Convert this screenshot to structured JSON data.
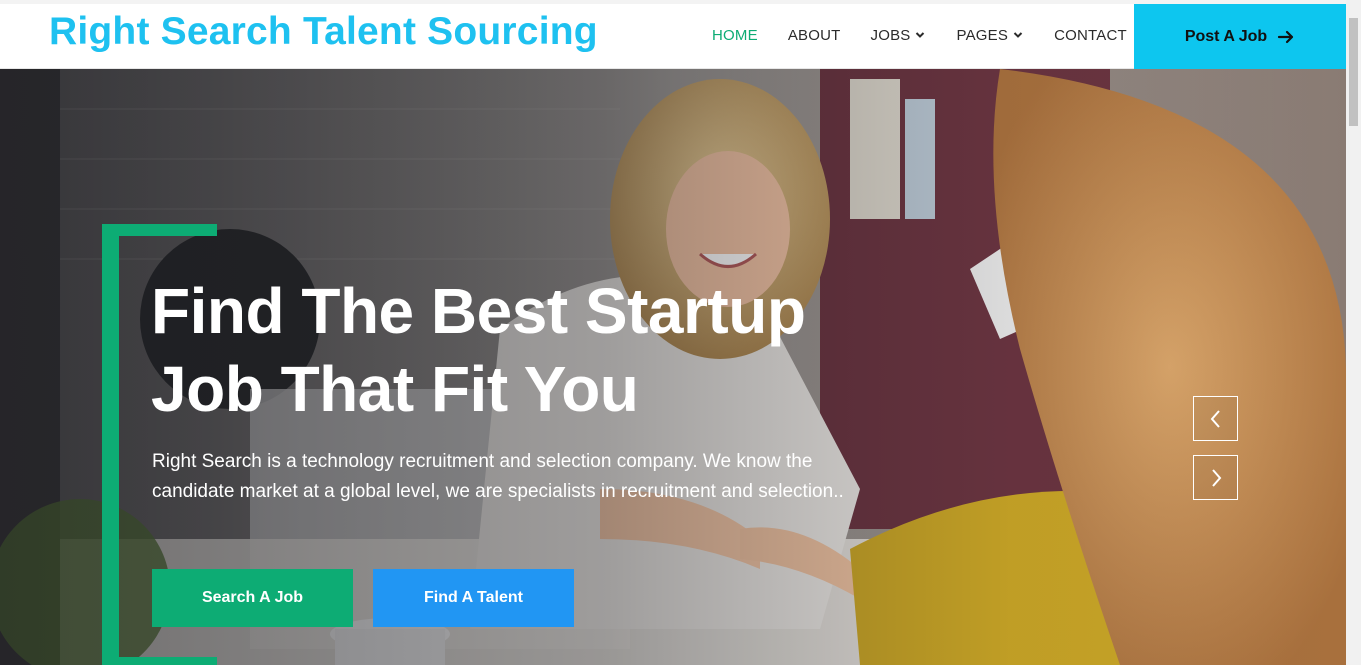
{
  "header": {
    "brand": "Right Search Talent Sourcing",
    "nav": [
      {
        "label": "HOME",
        "active": true,
        "dropdown": false
      },
      {
        "label": "ABOUT",
        "active": false,
        "dropdown": false
      },
      {
        "label": "JOBS",
        "active": false,
        "dropdown": true
      },
      {
        "label": "PAGES",
        "active": false,
        "dropdown": true
      },
      {
        "label": "CONTACT",
        "active": false,
        "dropdown": false
      }
    ],
    "cta_label": "Post A Job",
    "cta_icon": "arrow-right-icon"
  },
  "hero": {
    "title_line1": "Find The Best Startup",
    "title_line2": "Job That Fit You",
    "description": "Right Search is a technology recruitment and selection company. We know the candidate market at a global level, we are specialists in recruitment and selection..",
    "search_button": "Search A Job",
    "talent_button": "Find A Talent",
    "prev_icon": "chevron-left-icon",
    "next_icon": "chevron-right-icon"
  },
  "colors": {
    "brand": "#1ec1f0",
    "accent_green": "#0dac74",
    "accent_blue": "#2196f3",
    "cta_cyan": "#0dc6ef"
  }
}
